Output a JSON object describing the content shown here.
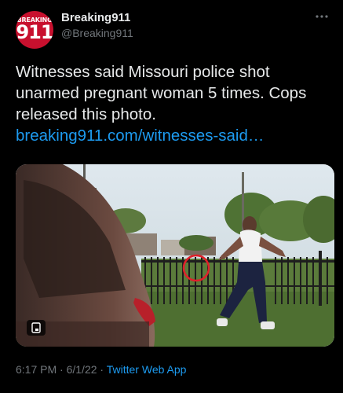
{
  "author": {
    "avatar_top_text": "BREAKING",
    "avatar_number": "911",
    "display_name": "Breaking911",
    "handle": "@Breaking911"
  },
  "more_icon": "more-horizontal-icon",
  "tweet": {
    "text": "Witnesses said Missouri police shot unarmed pregnant woman 5 times. Cops released this photo.",
    "link_text": "breaking911.com/witnesses-said…"
  },
  "media": {
    "alt_badge_icon": "media-badge-icon"
  },
  "footer": {
    "time": "6:17 PM",
    "separator": "·",
    "date": "6/1/22",
    "source": "Twitter Web App"
  },
  "colors": {
    "background": "#000000",
    "text": "#e7e9ea",
    "secondary": "#71767b",
    "link": "#1d9bf0",
    "avatar_red": "#c8102e"
  }
}
